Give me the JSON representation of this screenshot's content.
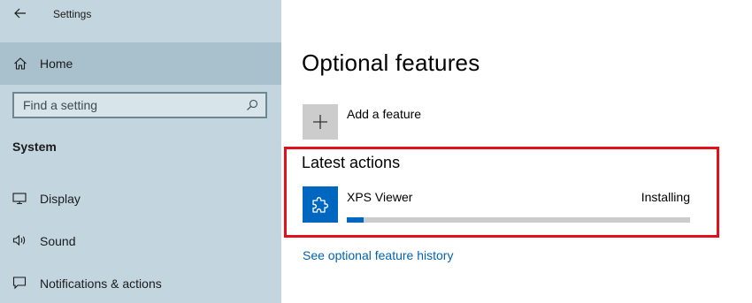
{
  "window": {
    "title": "Settings"
  },
  "sidebar": {
    "home_label": "Home",
    "search": {
      "placeholder": "Find a setting",
      "value": ""
    },
    "section_title": "System",
    "items": [
      {
        "label": "Display",
        "icon": "monitor-icon"
      },
      {
        "label": "Sound",
        "icon": "speaker-icon"
      },
      {
        "label": "Notifications & actions",
        "icon": "notification-icon"
      }
    ]
  },
  "main": {
    "title": "Optional features",
    "add_feature_label": "Add a feature",
    "latest_actions": {
      "heading": "Latest actions",
      "items": [
        {
          "name": "XPS Viewer",
          "status": "Installing",
          "progress": 0.05,
          "icon": "puzzle-icon"
        }
      ]
    },
    "history_link": "See optional feature history"
  },
  "colors": {
    "sidebar_bg": "#c3d6df",
    "sidebar_selected_bg": "#a9c1cc",
    "accent": "#0067c0",
    "link": "#0063b1",
    "highlight_border": "#e3101c",
    "progress_track": "#cccccc"
  }
}
